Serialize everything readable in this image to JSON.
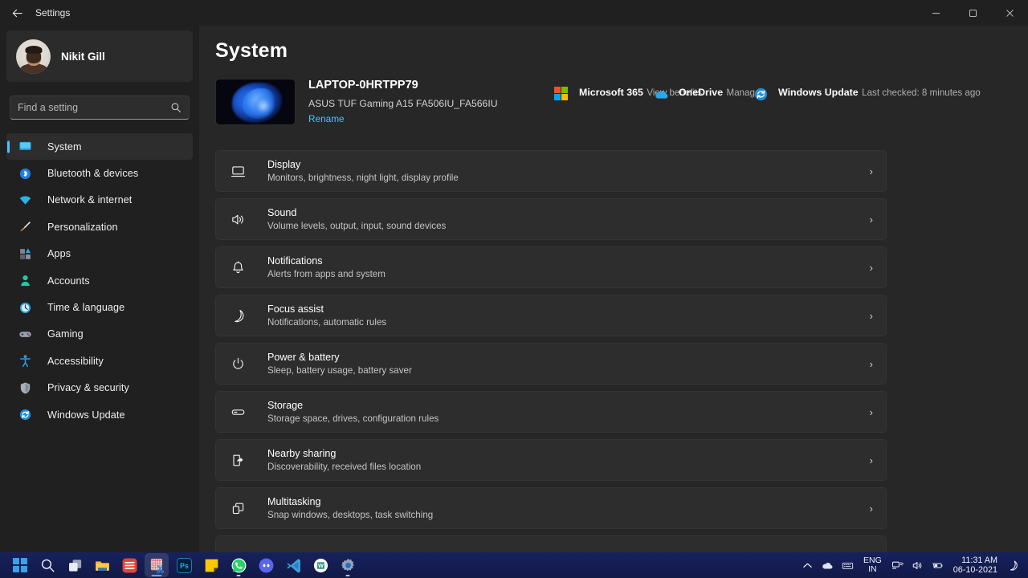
{
  "window": {
    "app_title": "Settings",
    "back_icon": "back-arrow-icon",
    "minimize_label": "–",
    "maximize_label": "□",
    "close_label": "×"
  },
  "sidebar": {
    "profile": {
      "name": "Nikit Gill",
      "avatar_icon": "avatar"
    },
    "search": {
      "placeholder": "Find a setting",
      "value": "",
      "icon": "search-icon"
    },
    "items": [
      {
        "label": "System",
        "icon": "system-icon",
        "selected": true
      },
      {
        "label": "Bluetooth & devices",
        "icon": "bluetooth-icon",
        "selected": false
      },
      {
        "label": "Network & internet",
        "icon": "wifi-icon",
        "selected": false
      },
      {
        "label": "Personalization",
        "icon": "paintbrush-icon",
        "selected": false
      },
      {
        "label": "Apps",
        "icon": "apps-grid-icon",
        "selected": false
      },
      {
        "label": "Accounts",
        "icon": "person-icon",
        "selected": false
      },
      {
        "label": "Time & language",
        "icon": "clock-icon",
        "selected": false
      },
      {
        "label": "Gaming",
        "icon": "gamepad-icon",
        "selected": false
      },
      {
        "label": "Accessibility",
        "icon": "accessibility-icon",
        "selected": false
      },
      {
        "label": "Privacy & security",
        "icon": "shield-icon",
        "selected": false
      },
      {
        "label": "Windows Update",
        "icon": "update-refresh-icon",
        "selected": false
      }
    ]
  },
  "main": {
    "page_title": "System",
    "device": {
      "name": "LAPTOP-0HRTPP79",
      "model": "ASUS TUF Gaming A15 FA506IU_FA566IU",
      "rename_label": "Rename",
      "thumbnail_icon": "windows-bloom-wallpaper"
    },
    "header_links": [
      {
        "title": "Microsoft 365",
        "subtitle": "View benefits",
        "icon": "microsoft-logo-icon"
      },
      {
        "title": "OneDrive",
        "subtitle": "Manage",
        "icon": "onedrive-cloud-icon"
      },
      {
        "title": "Windows Update",
        "subtitle": "Last checked: 8 minutes ago",
        "icon": "update-refresh-icon"
      }
    ],
    "settings_rows": [
      {
        "title": "Display",
        "subtitle": "Monitors, brightness, night light, display profile",
        "icon": "monitor-icon",
        "chevron": "›"
      },
      {
        "title": "Sound",
        "subtitle": "Volume levels, output, input, sound devices",
        "icon": "speaker-icon",
        "chevron": "›"
      },
      {
        "title": "Notifications",
        "subtitle": "Alerts from apps and system",
        "icon": "bell-icon",
        "chevron": "›"
      },
      {
        "title": "Focus assist",
        "subtitle": "Notifications, automatic rules",
        "icon": "moon-icon",
        "chevron": "›"
      },
      {
        "title": "Power & battery",
        "subtitle": "Sleep, battery usage, battery saver",
        "icon": "power-icon",
        "chevron": "›"
      },
      {
        "title": "Storage",
        "subtitle": "Storage space, drives, configuration rules",
        "icon": "storage-drive-icon",
        "chevron": "›"
      },
      {
        "title": "Nearby sharing",
        "subtitle": "Discoverability, received files location",
        "icon": "share-icon",
        "chevron": "›"
      },
      {
        "title": "Multitasking",
        "subtitle": "Snap windows, desktops, task switching",
        "icon": "multitasking-windows-icon",
        "chevron": "›"
      }
    ]
  },
  "taskbar": {
    "apps": [
      {
        "name": "start-button",
        "icon": "windows-start-icon",
        "state": "idle"
      },
      {
        "name": "search-button",
        "icon": "search-icon",
        "state": "idle"
      },
      {
        "name": "task-view-button",
        "icon": "task-view-icon",
        "state": "idle"
      },
      {
        "name": "file-explorer-button",
        "icon": "folder-icon",
        "state": "idle"
      },
      {
        "name": "todoist-button",
        "icon": "todoist-icon",
        "state": "idle"
      },
      {
        "name": "snipping-tool-button",
        "icon": "snipping-tool-icon",
        "state": "active"
      },
      {
        "name": "photoshop-button",
        "icon": "photoshop-icon",
        "state": "idle"
      },
      {
        "name": "sticky-notes-button",
        "icon": "sticky-notes-icon",
        "state": "idle"
      },
      {
        "name": "whatsapp-button",
        "icon": "whatsapp-icon",
        "state": "running"
      },
      {
        "name": "discord-button",
        "icon": "discord-icon",
        "state": "idle"
      },
      {
        "name": "vscode-button",
        "icon": "vscode-icon",
        "state": "idle"
      },
      {
        "name": "word-button",
        "icon": "word-icon",
        "state": "idle"
      },
      {
        "name": "settings-button",
        "icon": "gear-icon",
        "state": "running"
      }
    ],
    "tray": {
      "overflow_icon": "chevron-up-icon",
      "onedrive_icon": "onedrive-cloud-icon",
      "keyboard_icon": "keyboard-icon",
      "language": "ENG",
      "region": "IN",
      "network_icon": "network-icon",
      "volume_icon": "volume-icon",
      "battery_icon": "battery-icon",
      "time": "11:31 AM",
      "date": "06-10-2021",
      "notifications_icon": "moon-icon"
    }
  },
  "colors": {
    "accent": "#4cc2ff",
    "window_bg": "#202020",
    "content_bg": "#272727",
    "card_bg": "#2d2d2d",
    "taskbar_bg": "#141d52"
  }
}
